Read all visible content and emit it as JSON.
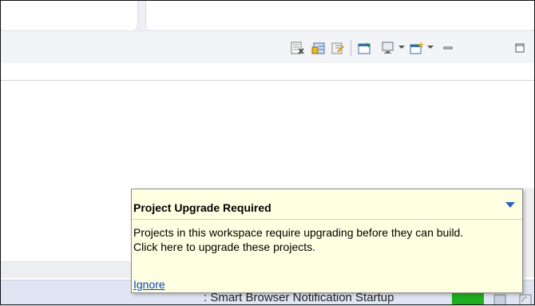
{
  "popup": {
    "title": "Project Upgrade Required",
    "message_line1": "Projects in this workspace require upgrading before they can build.",
    "message_line2": "Click here to upgrade these projects.",
    "ignore_link": "Ignore"
  },
  "status_bar": {
    "notification": ": Smart Browser Notification Startup"
  },
  "toolbar": {
    "icons": [
      "clear-console-icon",
      "new-report-icon",
      "edit-report-icon",
      "pin-view-icon",
      "display-selected-console-icon",
      "open-console-icon",
      "minimize-icon",
      "maximize-icon"
    ]
  },
  "colors": {
    "popup_background": "#ffffe1",
    "link": "#0645cc",
    "status_green": "#1fae1f"
  }
}
